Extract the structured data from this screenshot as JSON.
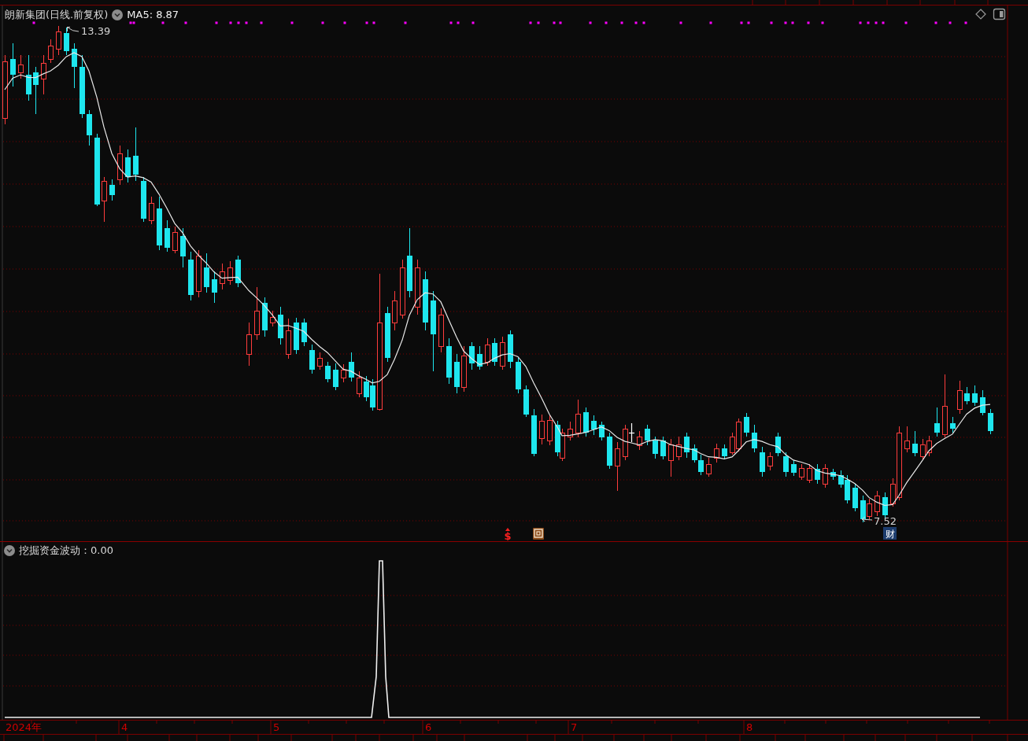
{
  "price_panel": {
    "title": "朗新集团(日线.前复权)",
    "ma_label": "MA5: 8.87",
    "high_label": "13.39",
    "low_label": "7.52",
    "event_markers": [
      {
        "kind": "symbol",
        "text": "$"
      },
      {
        "kind": "icon"
      },
      {
        "kind": "tag",
        "text": "财"
      }
    ]
  },
  "indicator_panel": {
    "title": "挖掘资金波动：0.00"
  },
  "time_axis": {
    "year_label": "2024年",
    "month_labels": [
      "4",
      "5",
      "6",
      "7",
      "8"
    ]
  }
}
